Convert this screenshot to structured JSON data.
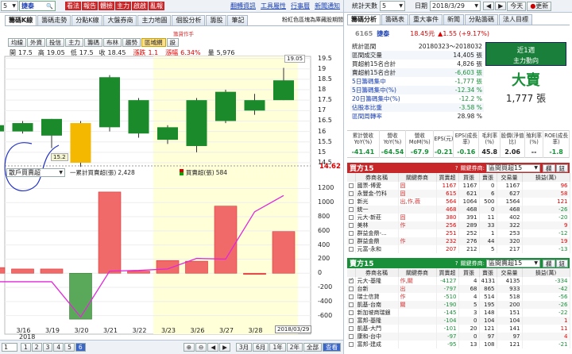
{
  "topbar": {
    "stock_select": "5",
    "stock_name": "捷泰",
    "buttons": [
      "看法",
      "報告",
      "體檢",
      "主力",
      "啟啟",
      "亂報"
    ],
    "links": [
      "翻轉資訊",
      "工具屬性",
      "行事曆",
      "新聞通知"
    ],
    "right_label": "統計天數",
    "days_select": "5",
    "date_label": "日期",
    "date_value": "2018/3/29",
    "today_btn": "今天",
    "refresh_btn": "更新",
    "search_icon": "search-icon",
    "refresh_icon": "refresh-icon"
  },
  "left_tabs": [
    "籌碼K線",
    "籌碼走勢",
    "分點K線",
    "大盤券商",
    "主力地圖",
    "個股分析",
    "籌股",
    "筆記"
  ],
  "left_note": "粉紅色區塊為庫藏股期間",
  "right_tabs": [
    "籌碼分析",
    "籌碼表",
    "重大事件",
    "新聞",
    "分點籌碼",
    "法人目標"
  ],
  "toolbar": {
    "buttons": [
      "均線",
      "外資",
      "投信",
      "主力",
      "籌碼",
      "布林",
      "趨勢",
      "區域網",
      "設"
    ],
    "active_index": 7,
    "note": "籌貸作手"
  },
  "ohlc": {
    "open_label": "開",
    "open": "17.5",
    "high_label": "高",
    "high": "19.05",
    "low_label": "低",
    "low": "17.5",
    "close_label": "收",
    "close": "18.45",
    "chg_label": "漲跌",
    "chg": "1.1",
    "pct_label": "漲幅",
    "pct": "6.34%",
    "vol_label": "量",
    "vol": "5,976"
  },
  "chart_data": [
    {
      "type": "candlestick",
      "categories": [
        "3/15",
        "3/16",
        "3/19",
        "3/20",
        "3/21",
        "3/22",
        "3/23",
        "3/26",
        "3/27",
        "3/28",
        "3/29"
      ],
      "open": [
        16.0,
        16.0,
        15.8,
        14.5,
        16.2,
        15.9,
        16.2,
        15.3,
        16.5,
        17.5,
        17.5
      ],
      "close": [
        16.3,
        16.4,
        16.6,
        16.4,
        18.6,
        17.5,
        15.6,
        17.5,
        17.9,
        17.0,
        18.45
      ],
      "high": [
        16.5,
        16.5,
        16.6,
        16.5,
        18.7,
        17.6,
        16.3,
        17.6,
        18.0,
        17.8,
        19.05
      ],
      "low": [
        15.8,
        15.9,
        15.2,
        14.3,
        16.0,
        15.7,
        15.4,
        15.0,
        16.4,
        16.8,
        17.5
      ],
      "colors": [
        "green",
        "green",
        "green",
        "yellow",
        "green",
        "green",
        "green",
        "green",
        "green",
        "green",
        "green"
      ],
      "ylim": [
        14.5,
        19.6
      ],
      "yticks": [
        "19.5",
        "19",
        "18.5",
        "18",
        "17.5",
        "17",
        "16.5",
        "16",
        "15.5",
        "15",
        "14.5"
      ],
      "price_tag_low": "15.2",
      "price_tag_high": "19.05",
      "last_price": "14.62",
      "highlight_from": "3/23",
      "highlight_to": "3/29"
    },
    {
      "type": "bar",
      "categories": [
        "3/15",
        "3/16",
        "3/19",
        "3/20",
        "3/21",
        "3/22",
        "3/23",
        "3/26",
        "3/27",
        "3/28",
        "3/29"
      ],
      "values": [
        80,
        60,
        60,
        -650,
        1150,
        30,
        180,
        170,
        950,
        0,
        590
      ],
      "cumulative": [
        -120,
        -120,
        -120,
        -620,
        30,
        40,
        60,
        210,
        200,
        870,
        1100
      ],
      "ylim": [
        -750,
        1250
      ],
      "yticks": [
        "1200",
        "1000",
        "800",
        "600",
        "400",
        "200",
        "0",
        "-200",
        "-400",
        "-600"
      ],
      "xticks": [
        "3/16",
        "3/19",
        "3/20",
        "3/21",
        "3/22",
        "3/23",
        "3/26",
        "3/27",
        "3/28"
      ],
      "year_label": "2018",
      "date_tag": "2018/03/29"
    }
  ],
  "sub_panel": {
    "select": "散戶買賣超",
    "legend1": "一累計買賣超(張)",
    "legend1_value": "2,428",
    "legend2": "買賣超(張)",
    "legend2_value": "584"
  },
  "stock_header": {
    "code": "6165",
    "name": "捷泰",
    "price": "18.45元",
    "change": "▲1.55 (+9.17%)"
  },
  "stats": [
    {
      "label": "統計區間",
      "value": "20180323～2018032"
    },
    {
      "label": "區間成交量",
      "value": "14,405 張"
    },
    {
      "label": "買超前15名合計",
      "value": "4,826 張"
    },
    {
      "label": "賣超前15名合計",
      "value": "-6,603 張"
    },
    {
      "label": "5日籌碼集中",
      "value": "-1,777 張"
    },
    {
      "label": "5日籌碼集中(%)",
      "value": "-12.34 %"
    },
    {
      "label": "20日籌碼集中(%)",
      "value": "-12.2 %"
    },
    {
      "label": "佔股本比重",
      "value": "-3.58 %"
    },
    {
      "label": "區間周轉率",
      "value": "28.98 %"
    }
  ],
  "trend_box": {
    "title": "近1週",
    "subtitle": "主力動向",
    "main": "大賣",
    "amount": "1,777 張"
  },
  "metrics": {
    "headers": [
      "累計營收YoY(%)",
      "營收YoY(%)",
      "營收MoM(%)",
      "EPS(元)",
      "EPS(成長率)",
      "毛利率(%)",
      "股價(淨值比)",
      "殖利率(%)",
      "ROE(成長率)"
    ],
    "values": [
      "-41.41",
      "-64.54",
      "-67.9",
      "-0.21",
      "-0.16",
      "45.8",
      "2.06",
      "--",
      "-1.8"
    ]
  },
  "buy_table": {
    "title": "買方15",
    "filter_label": "關鍵券商:",
    "filter_value": "區間買超15",
    "btn1": "欄",
    "btn2": "鈕",
    "headers": [
      "",
      "券商名稱",
      "關鍵券商",
      "買賣超",
      "買張",
      "賣張",
      "交易量",
      "損益(萬)"
    ],
    "rows": [
      [
        "",
        "國票-博愛",
        "固",
        "1167",
        "1167",
        "0",
        "1167",
        "96"
      ],
      [
        "",
        "永豐金-竹科",
        "固",
        "615",
        "621",
        "6",
        "627",
        "58"
      ],
      [
        "",
        "新光",
        "出,作,薇",
        "564",
        "1064",
        "500",
        "1564",
        "121"
      ],
      [
        "",
        "統一",
        "",
        "468",
        "468",
        "0",
        "468",
        "-26"
      ],
      [
        "",
        "元大-新莊",
        "固",
        "380",
        "391",
        "11",
        "402",
        "-20"
      ],
      [
        "",
        "美林",
        "作",
        "256",
        "289",
        "33",
        "322",
        "9"
      ],
      [
        "",
        "群益金鼎-...",
        "",
        "251",
        "252",
        "1",
        "253",
        "-12"
      ],
      [
        "",
        "群益金鼎",
        "作",
        "232",
        "276",
        "44",
        "320",
        "19"
      ],
      [
        "",
        "元富-永和",
        "",
        "207",
        "212",
        "5",
        "217",
        "-13"
      ]
    ]
  },
  "sell_table": {
    "title": "賣方15",
    "filter_label": "關鍵券商:",
    "filter_value": "區間賣超15",
    "btn1": "欄",
    "btn2": "鈕",
    "headers": [
      "",
      "券商名稱",
      "關鍵券商",
      "買賣超",
      "買張",
      "賣張",
      "交易量",
      "損益(萬)"
    ],
    "rows": [
      [
        "✓",
        "元大-基隆",
        "作,關",
        "-4127",
        "4",
        "4131",
        "4135",
        "-334"
      ],
      [
        "",
        "台新",
        "出",
        "-797",
        "68",
        "865",
        "933",
        "-42"
      ],
      [
        "",
        "瑞士信貸",
        "作",
        "-510",
        "4",
        "514",
        "518",
        "-56"
      ],
      [
        "",
        "凱基-台南",
        "關",
        "-190",
        "5",
        "195",
        "200",
        "-26"
      ],
      [
        "",
        "新加坡商瑞銀",
        "",
        "-145",
        "3",
        "148",
        "151",
        "-22"
      ],
      [
        "",
        "富邦-基隆",
        "",
        "-104",
        "0",
        "104",
        "104",
        "1"
      ],
      [
        "",
        "凱基-大門",
        "",
        "-101",
        "20",
        "121",
        "141",
        "11"
      ],
      [
        "",
        "康和-台中",
        "",
        "-97",
        "0",
        "97",
        "97",
        "4"
      ],
      [
        "",
        "富邦-建成",
        "",
        "-95",
        "13",
        "108",
        "121",
        "-21"
      ]
    ]
  },
  "bottom": {
    "left_select": "1",
    "page_btns": [
      "1",
      "2",
      "3",
      "4",
      "5",
      "6"
    ],
    "active_page": "6",
    "ranges": [
      "3月",
      "6月",
      "1年",
      "2年",
      "全部"
    ],
    "query": "查看"
  }
}
